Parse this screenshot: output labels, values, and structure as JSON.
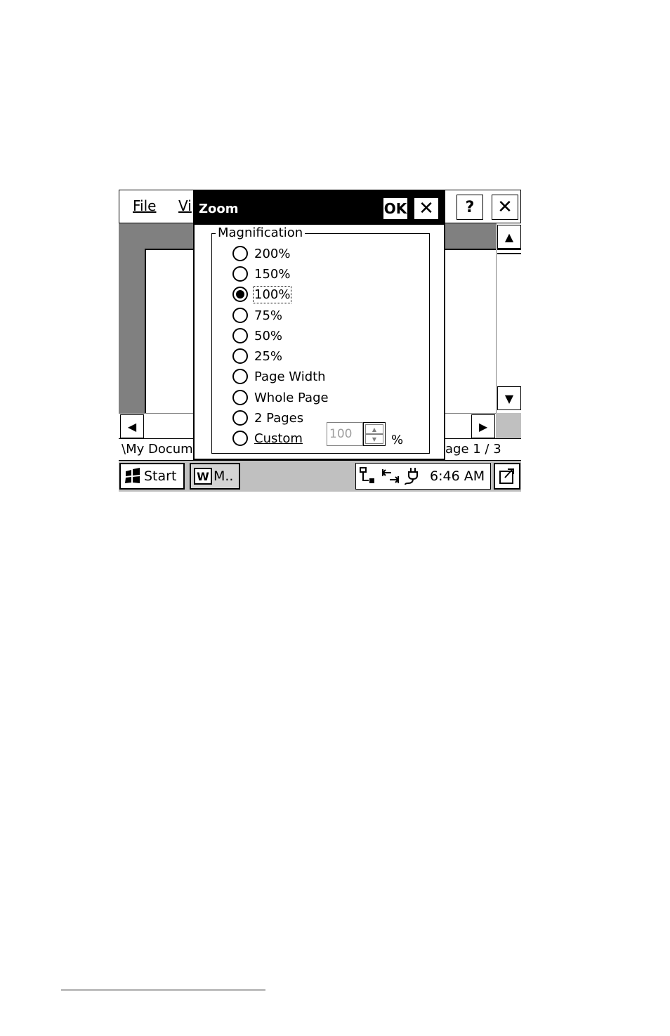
{
  "app": {
    "menu": {
      "file": "File",
      "view": "Vi"
    },
    "help_label": "?",
    "close_label": "✕"
  },
  "scrollbar": {
    "up": "▲",
    "down": "▼",
    "left": "◀",
    "right": "▶"
  },
  "status": {
    "path": "\\My Docume",
    "page": "age 1 / 3"
  },
  "taskbar": {
    "start_label": "Start",
    "task_label": "M..",
    "task_icon": "W",
    "clock": "6:46 AM"
  },
  "dialog": {
    "title": "Zoom",
    "ok_label": "OK",
    "close_label": "✕",
    "group_label": "Magnification",
    "options": [
      {
        "label": "200%",
        "selected": false
      },
      {
        "label": "150%",
        "selected": false
      },
      {
        "label": "100%",
        "selected": true
      },
      {
        "label": "75%",
        "selected": false
      },
      {
        "label": "50%",
        "selected": false
      },
      {
        "label": "25%",
        "selected": false
      },
      {
        "label": "Page Width",
        "selected": false
      },
      {
        "label": "Whole Page",
        "selected": false
      },
      {
        "label": "2 Pages",
        "selected": false
      },
      {
        "label": "Custom",
        "selected": false
      }
    ],
    "custom_value": "100",
    "percent_sign": "%"
  },
  "icons": [
    "windows-flag-icon",
    "word-document-icon",
    "network-icon",
    "sync-icon",
    "power-plug-icon",
    "desktop-icon"
  ]
}
